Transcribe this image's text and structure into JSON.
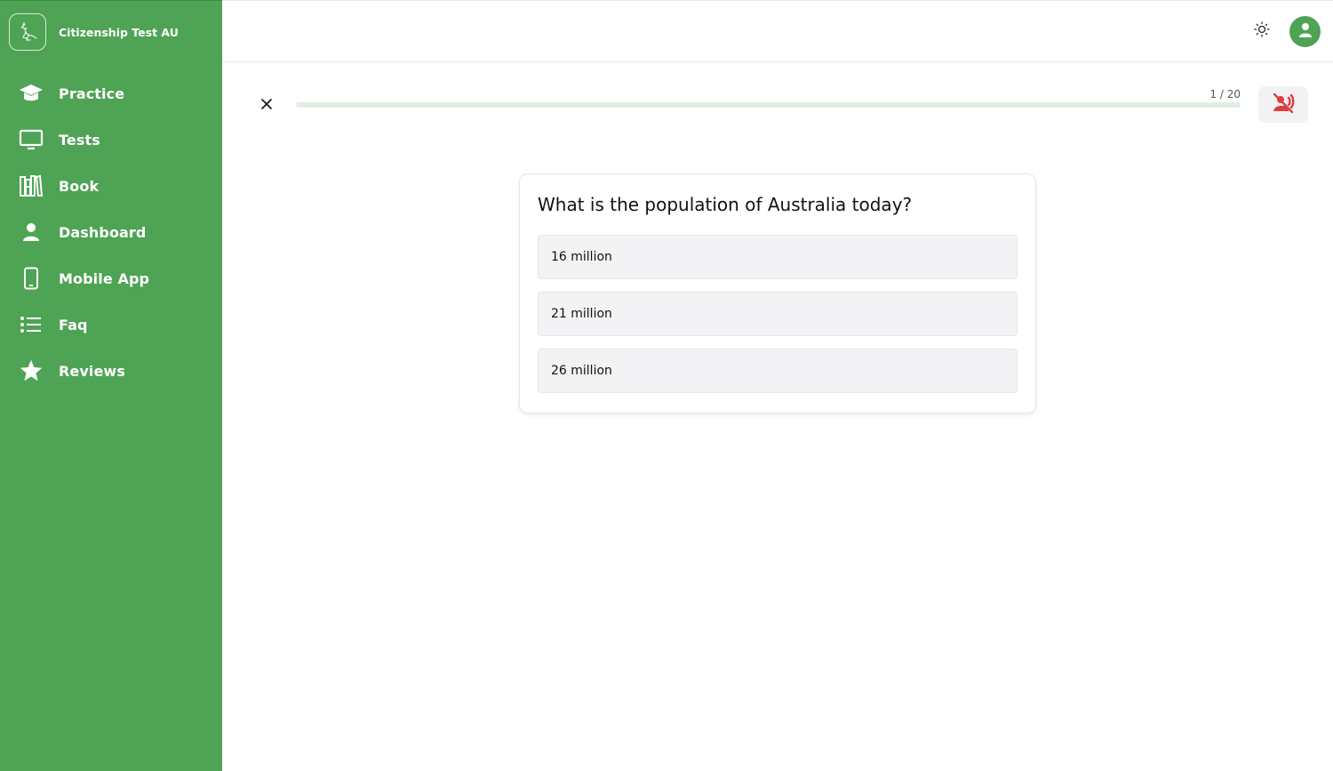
{
  "brand": {
    "name": "Citizenship Test AU",
    "logo_icon": "kangaroo-icon"
  },
  "sidebar": {
    "items": [
      {
        "label": "Practice",
        "icon": "graduation-cap-icon"
      },
      {
        "label": "Tests",
        "icon": "monitor-icon"
      },
      {
        "label": "Book",
        "icon": "books-icon"
      },
      {
        "label": "Dashboard",
        "icon": "user-icon"
      },
      {
        "label": "Mobile App",
        "icon": "mobile-phone-icon"
      },
      {
        "label": "Faq",
        "icon": "list-icon"
      },
      {
        "label": "Reviews",
        "icon": "star-icon"
      }
    ]
  },
  "topbar": {
    "theme_icon": "sun-icon",
    "avatar_icon": "user-icon"
  },
  "quiz": {
    "progress_text": "1 / 20",
    "current": 1,
    "total": 20,
    "progress_fill_fraction": 0,
    "question": "What is the population of Australia today?",
    "options": [
      "16 million",
      "21 million",
      "26 million"
    ]
  },
  "colors": {
    "brand_green": "#4ea354",
    "mute_red": "#e03c3c"
  }
}
